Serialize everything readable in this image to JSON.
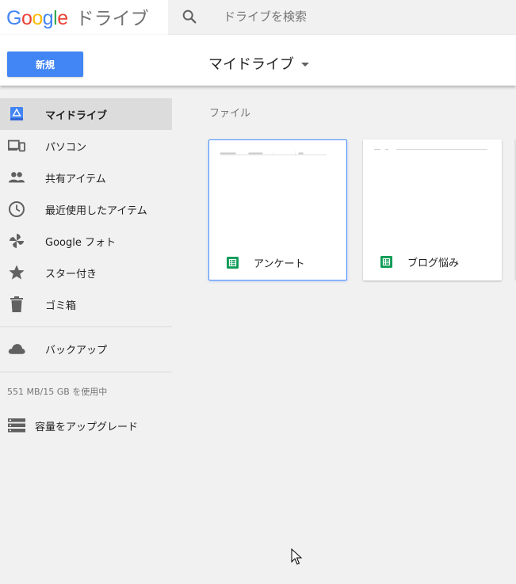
{
  "header": {
    "logo_letters": [
      "G",
      "o",
      "o",
      "g",
      "l",
      "e"
    ],
    "logo_colors": [
      "#4285f4",
      "#ea4335",
      "#fbbc05",
      "#4285f4",
      "#34a853",
      "#ea4335"
    ],
    "product": "ドライブ",
    "search_placeholder": "ドライブを検索",
    "search_icon": "search-icon"
  },
  "toolbar": {
    "new_label": "新規",
    "location_title": "マイドライブ"
  },
  "sidebar": {
    "items": [
      {
        "label": "マイドライブ",
        "icon": "my-drive-icon",
        "active": true
      },
      {
        "label": "パソコン",
        "icon": "computers-icon",
        "active": false
      },
      {
        "label": "共有アイテム",
        "icon": "shared-people-icon",
        "active": false
      },
      {
        "label": "最近使用したアイテム",
        "icon": "clock-icon",
        "active": false
      },
      {
        "label": "Google フォト",
        "icon": "pinwheel-icon",
        "active": false
      },
      {
        "label": "スター付き",
        "icon": "star-icon",
        "active": false
      },
      {
        "label": "ゴミ箱",
        "icon": "trash-icon",
        "active": false
      }
    ],
    "backup_label": "バックアップ",
    "storage_text": "551 MB/15 GB を使用中",
    "upgrade_label": "容量をアップグレード"
  },
  "main": {
    "section_title": "ファイル",
    "files": [
      {
        "name": "アンケート",
        "type": "sheets",
        "selected": true
      },
      {
        "name": "ブログ悩み",
        "type": "sheets",
        "selected": false
      }
    ]
  },
  "colors": {
    "accent": "#4285f4",
    "sheets_green": "#0f9d58",
    "selected_border": "#4d90fe"
  }
}
